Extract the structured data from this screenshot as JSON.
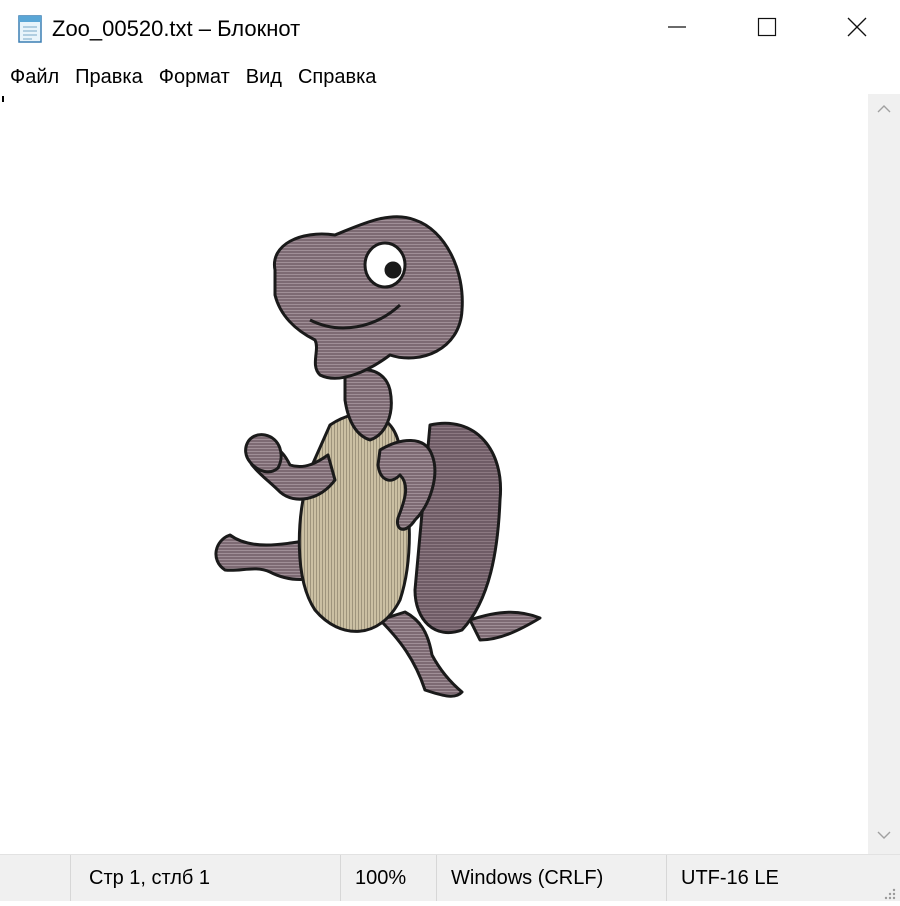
{
  "window": {
    "title": "Zoo_00520.txt – Блокнот",
    "app_icon": "notepad-icon",
    "controls": {
      "minimize_icon": "minimize-icon",
      "maximize_icon": "maximize-icon",
      "close_icon": "close-icon"
    }
  },
  "menu": {
    "items": [
      {
        "label": "Файл"
      },
      {
        "label": "Правка"
      },
      {
        "label": "Формат"
      },
      {
        "label": "Вид"
      },
      {
        "label": "Справка"
      }
    ]
  },
  "editor": {
    "content_description_icon": "ascii-art-turtle-icon",
    "scroll_up_icon": "chevron-up-icon",
    "scroll_down_icon": "chevron-down-icon"
  },
  "status": {
    "position": "Стр 1, стлб 1",
    "zoom": "100%",
    "line_endings": "Windows (CRLF)",
    "encoding": "UTF-16 LE"
  },
  "colors": {
    "turtle_body": "#7d6a73",
    "turtle_shell_belly": "#cbc0a3",
    "outline": "#1a1a1a",
    "background": "#ffffff",
    "statusbar": "#f0f0f0"
  }
}
